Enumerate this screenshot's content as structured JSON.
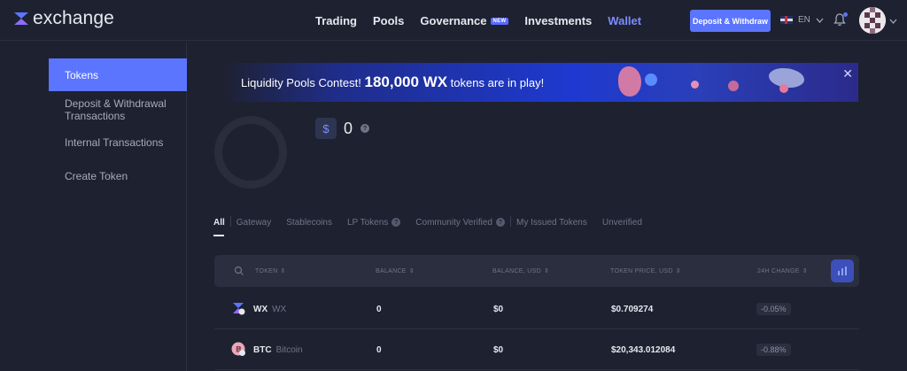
{
  "header": {
    "logo_text": "exchange",
    "nav": [
      {
        "label": "Trading",
        "badge": ""
      },
      {
        "label": "Pools",
        "badge": ""
      },
      {
        "label": "Governance",
        "badge": "NEW"
      },
      {
        "label": "Investments",
        "badge": ""
      },
      {
        "label": "Wallet",
        "badge": "",
        "active": true
      }
    ],
    "deposit_label": "Deposit & Withdraw",
    "language": "EN"
  },
  "sidebar": {
    "items": [
      {
        "label": "Tokens",
        "active": true
      },
      {
        "label": "Deposit & Withdrawal Transactions"
      },
      {
        "label": "Internal Transactions"
      },
      {
        "label": "Create Token"
      }
    ]
  },
  "banner": {
    "prefix": "Liquidity Pools Contest!",
    "amount": "180,000 WX",
    "suffix": "tokens are in play!"
  },
  "portfolio": {
    "currency_symbol": "$",
    "total": "0"
  },
  "tabs": [
    {
      "label": "All",
      "active": true
    },
    {
      "label": "Gateway"
    },
    {
      "label": "Stablecoins"
    },
    {
      "label": "LP Tokens",
      "help": true
    },
    {
      "label": "Community Verified",
      "help": true
    },
    {
      "label": "My Issued Tokens"
    },
    {
      "label": "Unverified"
    }
  ],
  "table": {
    "columns": [
      "TOKEN",
      "BALANCE",
      "BALANCE, USD",
      "TOKEN PRICE, USD",
      "24H CHANGE"
    ],
    "rows": [
      {
        "symbol": "WX",
        "name": "WX",
        "balance": "0",
        "balance_usd": "$0",
        "price": "$0.709274",
        "change": "-0.05%"
      },
      {
        "symbol": "BTC",
        "name": "Bitcoin",
        "balance": "0",
        "balance_usd": "$0",
        "price": "$20,343.012084",
        "change": "-0.88%"
      }
    ]
  },
  "colors": {
    "accent": "#5b75ff",
    "background": "#1e2130"
  }
}
